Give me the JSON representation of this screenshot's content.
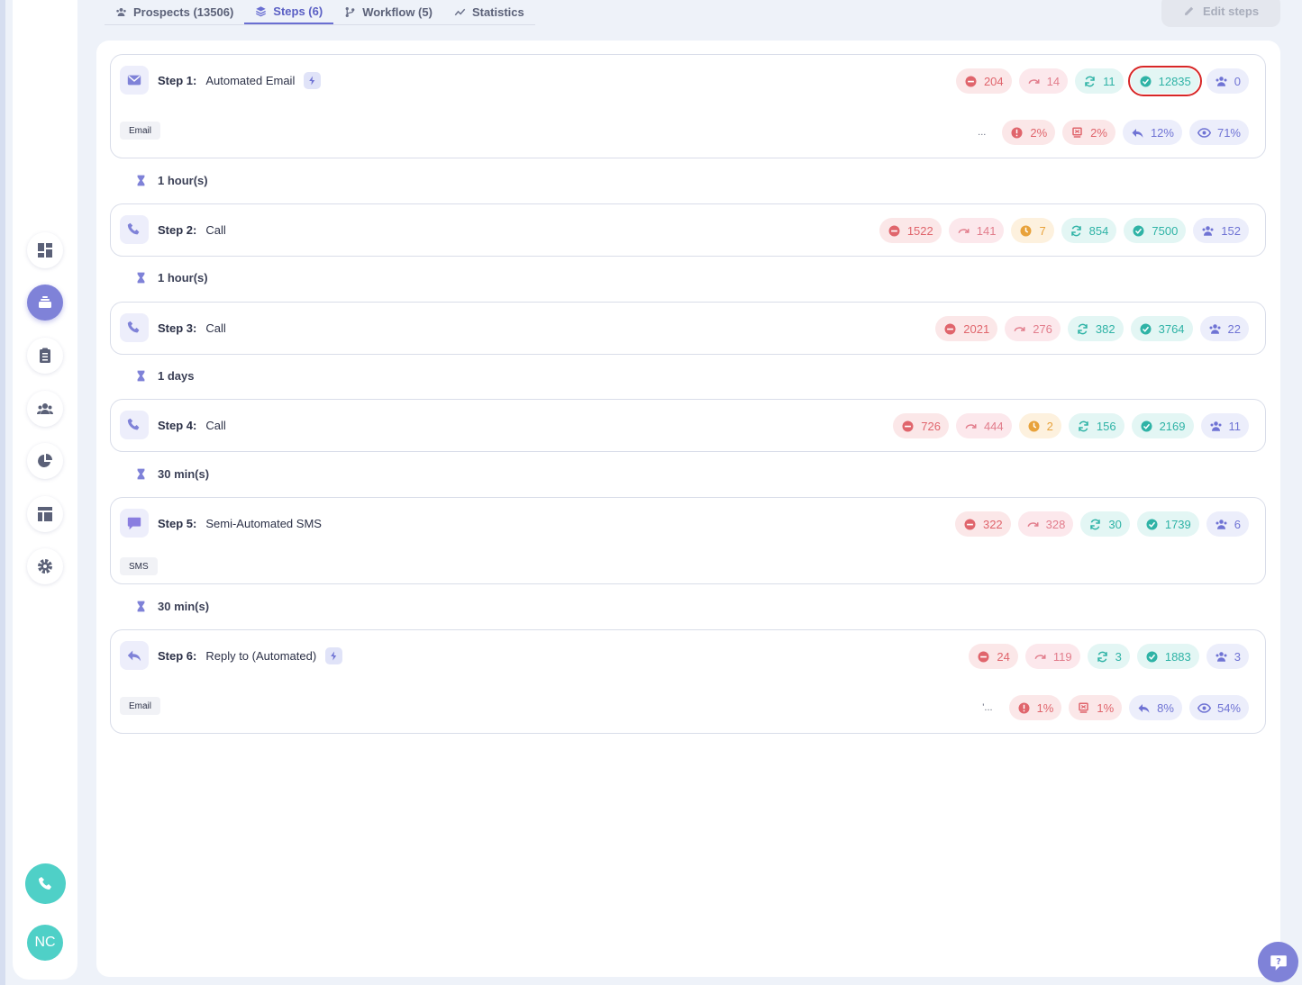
{
  "tabs": [
    {
      "label": "Prospects (13506)",
      "icon": "users-icon",
      "active": false
    },
    {
      "label": "Steps (6)",
      "icon": "layers-icon",
      "active": true
    },
    {
      "label": "Workflow (5)",
      "icon": "workflow-icon",
      "active": false
    },
    {
      "label": "Statistics",
      "icon": "chart-line-icon",
      "active": false
    }
  ],
  "edit_steps_label": "Edit steps",
  "sidebar": {
    "items": [
      "dashboard-icon",
      "sequences-icon",
      "tasks-icon",
      "contacts-icon",
      "reports-icon",
      "templates-icon",
      "settings-icon"
    ],
    "active_index": 1,
    "avatar_initials": "NC"
  },
  "steps": [
    {
      "number": "Step 1:",
      "title": "Automated Email",
      "type": "email",
      "automated": true,
      "stats": [
        "204",
        "14",
        "11",
        "12835",
        "0"
      ],
      "tag": "Email",
      "ellipsis": "...",
      "rates": [
        "2%",
        "2%",
        "12%",
        "71%"
      ]
    },
    {
      "number": "Step 2:",
      "title": "Call",
      "type": "call",
      "stats": [
        "1522",
        "141",
        "7",
        "854",
        "7500",
        "152"
      ]
    },
    {
      "number": "Step 3:",
      "title": "Call",
      "type": "call",
      "stats": [
        "2021",
        "276",
        "382",
        "3764",
        "22"
      ]
    },
    {
      "number": "Step 4:",
      "title": "Call",
      "type": "call",
      "stats": [
        "726",
        "444",
        "2",
        "156",
        "2169",
        "11"
      ]
    },
    {
      "number": "Step 5:",
      "title": "Semi-Automated SMS",
      "type": "sms",
      "stats": [
        "322",
        "328",
        "30",
        "1739",
        "6"
      ],
      "tag": "SMS"
    },
    {
      "number": "Step 6:",
      "title": "Reply to (Automated)",
      "type": "reply",
      "automated": true,
      "stats": [
        "24",
        "119",
        "3",
        "1883",
        "3"
      ],
      "tag": "Email",
      "ellipsis": "'...",
      "rates": [
        "1%",
        "1%",
        "8%",
        "54%"
      ]
    }
  ],
  "delays": [
    "1 hour(s)",
    "1 hour(s)",
    "1 days",
    "30 min(s)",
    "30 min(s)"
  ],
  "colors": {
    "accent": "#6a6fd2",
    "red": "#e0656c",
    "pink": "#e27d8c",
    "amber": "#e8a23b",
    "teal": "#2fb3a6",
    "purple": "#6f73d4",
    "highlight_outline": "#d72727"
  }
}
